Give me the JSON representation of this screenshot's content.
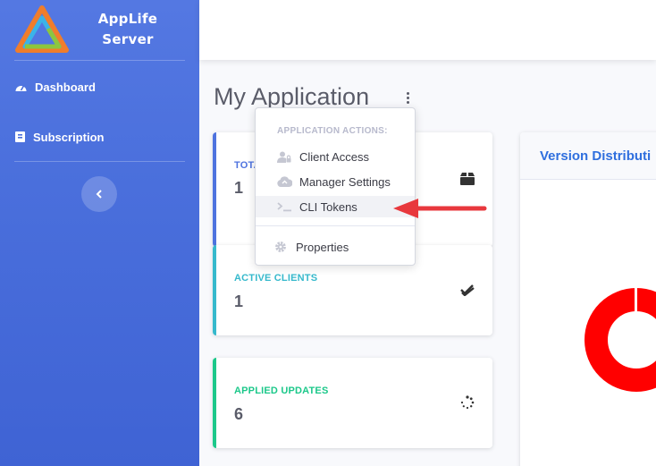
{
  "brand": {
    "line1": "AppLife",
    "line2": "Server"
  },
  "sidebar": {
    "items": [
      {
        "label": "Dashboard",
        "icon": "tachometer-icon"
      },
      {
        "label": "Subscription",
        "icon": "book-icon"
      }
    ],
    "toggle_icon": "chevron-left-icon"
  },
  "main": {
    "title": "My Application"
  },
  "cards": [
    {
      "label": "TOTA",
      "value": "1",
      "color": "#4e73df",
      "icon": "box-icon"
    },
    {
      "label": "ACTIVE CLIENTS",
      "value": "1",
      "color": "#36b9cc",
      "icon": "double-check-icon"
    },
    {
      "label": "APPLIED UPDATES",
      "value": "6",
      "color": "#1cc88a",
      "icon": "spinner-icon"
    }
  ],
  "panel": {
    "title": "Version Distributi"
  },
  "dropdown": {
    "header": "APPLICATION ACTIONS:",
    "items": [
      {
        "label": "Client Access",
        "icon": "user-lock-icon"
      },
      {
        "label": "Manager Settings",
        "icon": "cloud-icon"
      },
      {
        "label": "CLI Tokens",
        "icon": "terminal-icon"
      },
      {
        "label": "Properties",
        "icon": "gear-icon"
      }
    ]
  },
  "colors": {
    "sidebar": "#4a6fdc",
    "annotation_arrow": "#e8383d",
    "donut": "#ff0000"
  }
}
